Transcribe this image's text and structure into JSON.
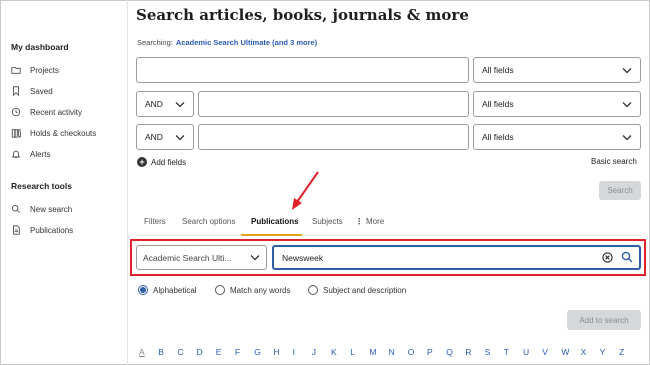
{
  "sidebar": {
    "dashboard_heading": "My dashboard",
    "dashboard_items": [
      {
        "label": "Projects",
        "icon": "folder-icon"
      },
      {
        "label": "Saved",
        "icon": "bookmark-icon"
      },
      {
        "label": "Recent activity",
        "icon": "history-icon"
      },
      {
        "label": "Holds & checkouts",
        "icon": "books-icon"
      },
      {
        "label": "Alerts",
        "icon": "bell-icon"
      }
    ],
    "research_heading": "Research tools",
    "research_items": [
      {
        "label": "New search",
        "icon": "search-icon"
      },
      {
        "label": "Publications",
        "icon": "document-icon"
      }
    ]
  },
  "main": {
    "title": "Search articles, books, journals & more",
    "searching_label": "Searching:",
    "searching_link": "Academic Search Ultimate (and 3 more)",
    "rows": [
      {
        "operator": "",
        "field": "All fields",
        "value": ""
      },
      {
        "operator": "AND",
        "field": "All fields",
        "value": ""
      },
      {
        "operator": "AND",
        "field": "All fields",
        "value": ""
      }
    ],
    "add_fields": "Add fields",
    "basic_search": "Basic search",
    "search_button": "Search",
    "tabs": [
      "Filters",
      "Search options",
      "Publications",
      "Subjects",
      "More"
    ],
    "active_tab": "Publications",
    "publication_database": "Academic Search Ulti...",
    "publication_query": "Newsweek",
    "radio_options": [
      "Alphabetical",
      "Match any words",
      "Subject and description"
    ],
    "radio_selected": "Alphabetical",
    "add_to_search": "Add to search",
    "alphabet": [
      "A",
      "B",
      "C",
      "D",
      "E",
      "F",
      "G",
      "H",
      "I",
      "J",
      "K",
      "L",
      "M",
      "N",
      "O",
      "P",
      "Q",
      "R",
      "S",
      "T",
      "U",
      "V",
      "W",
      "X",
      "Y",
      "Z"
    ]
  },
  "colors": {
    "accent": "#2f5da8",
    "link": "#2a5ab5",
    "tab_underline": "#e0a31a",
    "annotation_red": "#e0232b"
  }
}
